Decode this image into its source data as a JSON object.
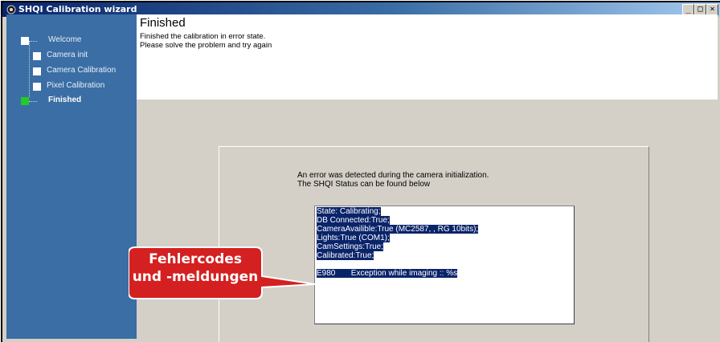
{
  "window": {
    "title": "SHQI Calibration wizard",
    "controls": [
      "_",
      "□",
      "×"
    ]
  },
  "sidebar": {
    "steps": [
      {
        "label": "Welcome",
        "state": "done"
      },
      {
        "label": "Camera init",
        "state": "done"
      },
      {
        "label": "Camera Calibration",
        "state": "done"
      },
      {
        "label": "Pixel Calibration",
        "state": "done"
      },
      {
        "label": "Finished",
        "state": "current"
      }
    ]
  },
  "header": {
    "title": "Finished",
    "line1": "Finished the calibration in error state.",
    "line2": "Please solve the problem and try again"
  },
  "panel": {
    "message_line1": "An error was detected during the camera initialization.",
    "message_line2": "The SHQI Status can be found below",
    "status_lines": [
      "State: Calibrating;",
      "DB Connected:True;",
      "CameraAvailible:True (MC2587, , RG 10bits);",
      "Lights:True (COM1);",
      "CamSettings:True;",
      "Calibrated:True;",
      "",
      "E980       Exception while imaging :: %s"
    ]
  },
  "callout": {
    "line1": "Fehlercodes",
    "line2": "und -meldungen",
    "color": "#d42020"
  }
}
